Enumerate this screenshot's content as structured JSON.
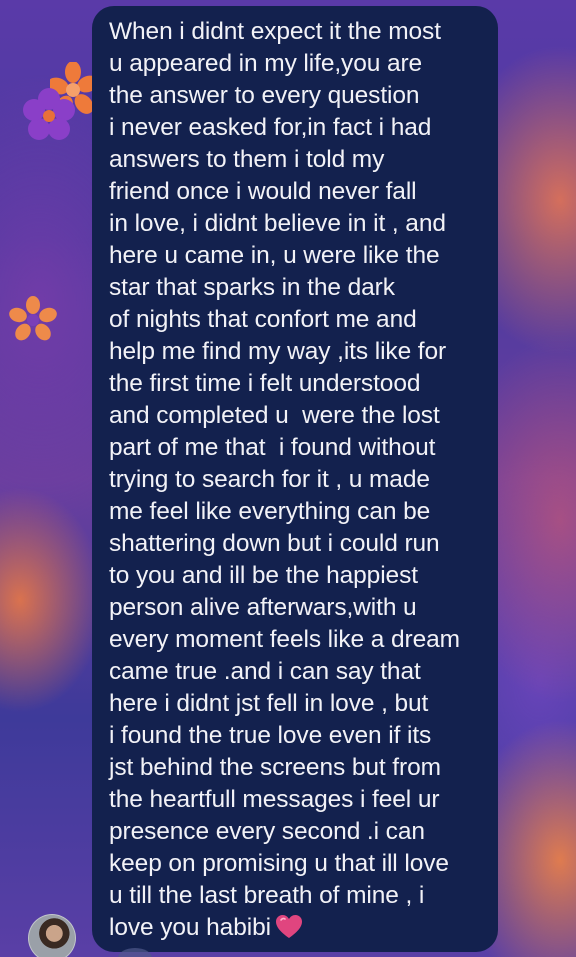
{
  "message": {
    "lines": [
      "When i didnt expect it the most",
      "u appeared in my life,you are",
      "the answer to every question",
      "i never easked for,in fact i had",
      "answers to them i told my",
      "friend once i would never fall",
      "in love, i didnt believe in it , and",
      "here u came in, u were like the",
      "star that sparks in the dark",
      "of nights that confort me and",
      "help me find my way ,its like for",
      "the first time i felt understood",
      "and completed u  were the lost",
      "part of me that  i found without",
      "trying to search for it , u made",
      "me feel like everything can be",
      "shattering down but i could run",
      "to you and ill be the happiest",
      "person alive afterwars,with u",
      "every moment feels like a dream",
      "came true .and i can say that",
      "here i didnt jst fell in love , but",
      "i found the true love even if its",
      "jst behind the screens but from",
      "the heartfull messages i feel ur",
      "presence every second .i can",
      "keep on promising u that ill love",
      "u till the last breath of mine , i",
      "love you habibi"
    ],
    "emoji": "heart-icon",
    "bubble_color": "#13214e",
    "text_color": "#f2f2f7"
  },
  "background": {
    "decorations": [
      "flower-icon-orange",
      "flower-icon-purple",
      "flower-icon-small-orange"
    ]
  },
  "sender": {
    "avatar": "avatar"
  }
}
